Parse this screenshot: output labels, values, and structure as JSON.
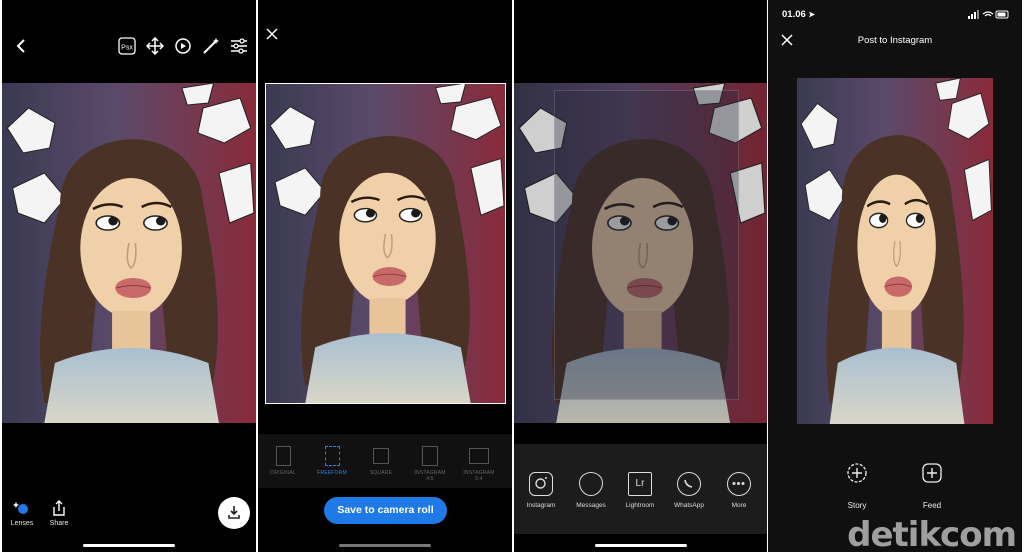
{
  "editor": {
    "lenses_label": "Lenses",
    "share_label": "Share",
    "psx_label": "Psx"
  },
  "crop": {
    "ratios": [
      {
        "label": "ORIGINAL",
        "sub": ""
      },
      {
        "label": "FREEFORM",
        "sub": ""
      },
      {
        "label": "SQUARE",
        "sub": ""
      },
      {
        "label": "INSTAGRAM",
        "sub": "4:5"
      },
      {
        "label": "INSTAGRAM",
        "sub": "5:4"
      }
    ],
    "save_label": "Save to camera roll"
  },
  "share": {
    "items": [
      {
        "label": "Instagram"
      },
      {
        "label": "Messages"
      },
      {
        "label": "Lightroom",
        "glyph": "Lr"
      },
      {
        "label": "WhatsApp"
      },
      {
        "label": "More"
      }
    ]
  },
  "instagram": {
    "time": "01.06",
    "title": "Post to Instagram",
    "story_label": "Story",
    "feed_label": "Feed"
  },
  "watermark": "detikcom",
  "colors": {
    "accent": "#1f79e6",
    "background": "#000000"
  }
}
